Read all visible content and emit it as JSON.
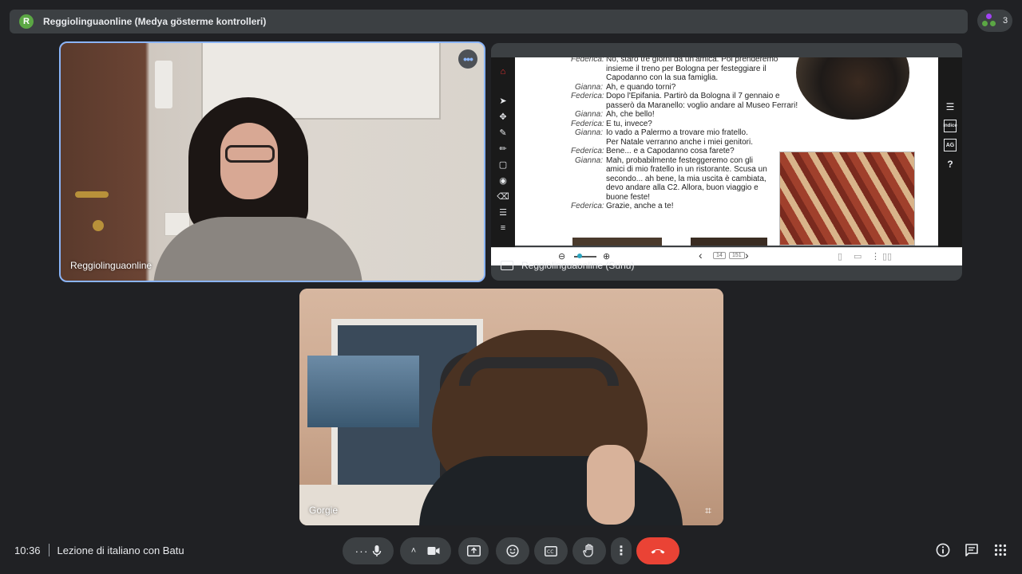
{
  "topbar": {
    "avatar_letter": "R",
    "title": "Reggiolinguaonline (Medya gösterme kontrolleri)"
  },
  "people": {
    "count": "3"
  },
  "tiles": {
    "teacher": {
      "label": "Reggiolinguaonline"
    },
    "presentation": {
      "label": "Reggiolinguaonline (Sunu)",
      "page_current": "14",
      "page_total": "151",
      "dialogue": [
        {
          "speaker": "Federica:",
          "text": "No, starò tre giorni da un'amica. Poi prenderemo"
        },
        {
          "speaker": "",
          "text": "insieme il treno per Bologna per festeggiare il"
        },
        {
          "speaker": "",
          "text": "Capodanno con la sua famiglia."
        },
        {
          "speaker": "Gianna:",
          "text": "Ah, e quando torni?"
        },
        {
          "speaker": "Federica:",
          "text": "Dopo l'Epifania. Partirò da Bologna il 7 gennaio e"
        },
        {
          "speaker": "",
          "text": "passerò da Maranello: voglio andare al Museo Ferrari!"
        },
        {
          "speaker": "Gianna:",
          "text": "Ah, che bello!"
        },
        {
          "speaker": "Federica:",
          "text": "E tu, invece?"
        },
        {
          "speaker": "Gianna:",
          "text": "Io vado a Palermo a trovare mio fratello."
        },
        {
          "speaker": "",
          "text": "Per Natale verranno anche i miei genitori."
        },
        {
          "speaker": "Federica:",
          "text": "Bene... e a Capodanno cosa farete?"
        },
        {
          "speaker": "Gianna:",
          "text": "Mah, probabilmente festeggeremo con gli"
        },
        {
          "speaker": "",
          "text": "amici di mio fratello in un ristorante. Scusa un"
        },
        {
          "speaker": "",
          "text": "secondo... ah bene, la mia uscita è cambiata,"
        },
        {
          "speaker": "",
          "text": "devo andare alla C2. Allora, buon viaggio e"
        },
        {
          "speaker": "",
          "text": "buone feste!"
        },
        {
          "speaker": "Federica:",
          "text": "Grazie, anche a te!"
        }
      ],
      "right_tools": {
        "index": "indice",
        "ag": "AG",
        "help": "?"
      }
    },
    "student": {
      "label": "Gorgie"
    }
  },
  "footer": {
    "time": "10:36",
    "meeting_title": "Lezione di italiano con Batu"
  },
  "colors": {
    "background": "#202124",
    "surface": "#3c4043",
    "active_border": "#8ab4f8",
    "end_call": "#ea4335",
    "avatar": "#5ba744"
  },
  "icons": [
    "more-options-icon",
    "microphone-icon",
    "chevron-up-icon",
    "camera-icon",
    "present-icon",
    "emoji-icon",
    "captions-icon",
    "raise-hand-icon",
    "more-vert-icon",
    "end-call-icon",
    "info-icon",
    "chat-icon",
    "apps-icon",
    "crop-icon",
    "tile-more-icon"
  ]
}
